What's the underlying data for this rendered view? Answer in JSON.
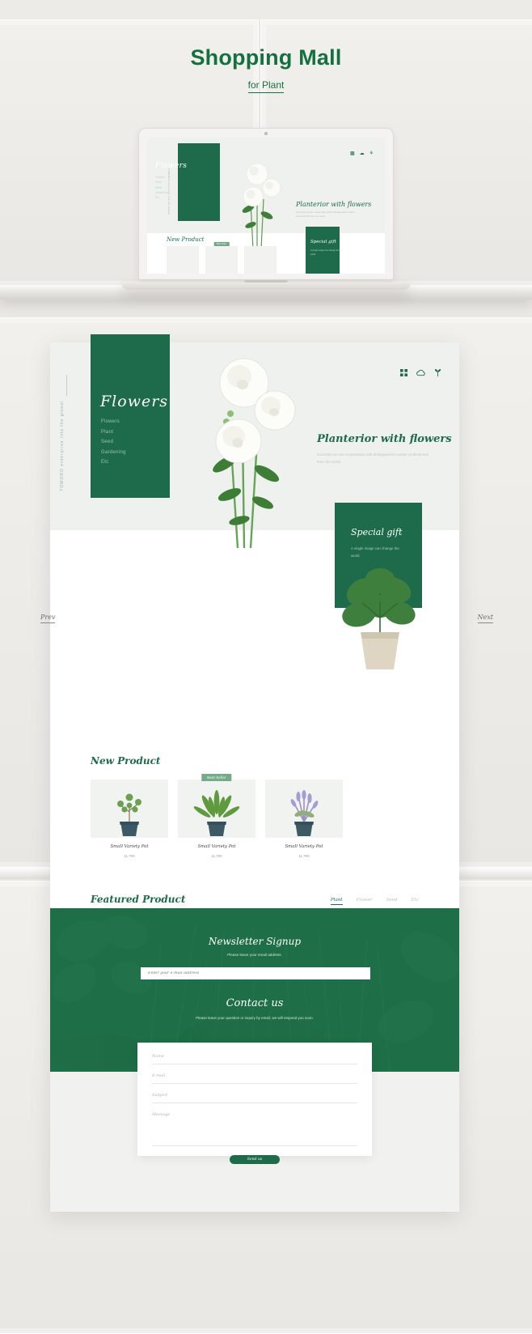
{
  "header": {
    "title": "Shopping Mall",
    "subtitle": "for Plant"
  },
  "site": {
    "logo": "Flowers",
    "vertical_text": "TOMORO enterprise into the global",
    "nav": [
      "Flowers",
      "Plant",
      "Seed",
      "Gardening",
      "Etc"
    ],
    "icons": [
      "grid-icon",
      "cloud-icon",
      "plant-icon"
    ]
  },
  "hero": {
    "heading": "Planterior with flowers",
    "paragraph": "Currently we are cooperating with distinguished master professional from the world."
  },
  "gift": {
    "title": "Special gift",
    "paragraph": "A single image can change the world."
  },
  "new_product": {
    "title": "New Product",
    "badge": "Best Seller",
    "items": [
      {
        "name": "Small Variety Pot",
        "price": "11,700"
      },
      {
        "name": "Small Variety Pot",
        "price": "11,700"
      },
      {
        "name": "Small Variety Pot",
        "price": "11,700"
      }
    ]
  },
  "featured_product": {
    "title": "Featured Product",
    "tabs": [
      "Plant",
      "Flower",
      "Seed",
      "Etc"
    ],
    "active_tab": "Plant",
    "favorite_icon": "heart-icon"
  },
  "newsletter": {
    "title": "Newsletter Signup",
    "subtitle": "Please leave your email address.",
    "placeholder": "Enter your e-mail address"
  },
  "contact": {
    "title": "Contact us",
    "subtitle": "Please leave your question or inquiry by email, we will respond you soon.",
    "fields": [
      "Name",
      "E-mail",
      "Subject",
      "Message"
    ],
    "send_label": "Send us"
  },
  "carousel": {
    "prev": "Prev",
    "next": "Next"
  },
  "colors": {
    "brand_green": "#1d6b4b",
    "title_green": "#15703f",
    "badge_green": "#76ab8a",
    "hero_bg": "#eef1ee"
  }
}
